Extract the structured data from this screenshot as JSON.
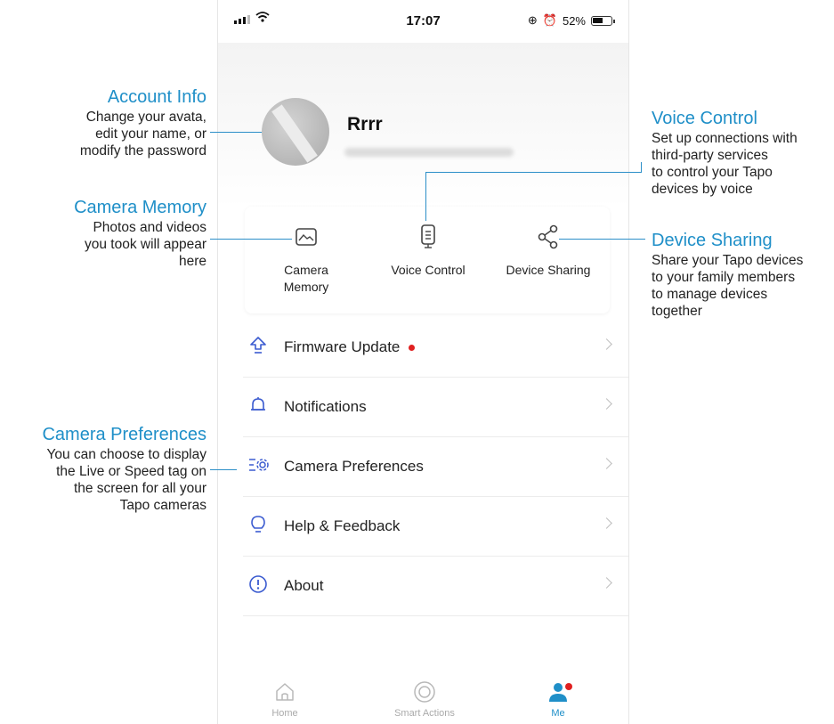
{
  "status_bar": {
    "time": "17:07",
    "battery": "52%"
  },
  "profile": {
    "username": "Rrrr"
  },
  "features": [
    {
      "label": "Camera\nMemory",
      "icon": "picture-icon"
    },
    {
      "label": "Voice Control",
      "icon": "speaker-icon"
    },
    {
      "label": "Device Sharing",
      "icon": "share-icon"
    }
  ],
  "menu": [
    {
      "label": "Firmware Update",
      "icon": "upload-icon",
      "has_dot": true
    },
    {
      "label": "Notifications",
      "icon": "bell-icon"
    },
    {
      "label": "Camera Preferences",
      "icon": "camera-settings-icon"
    },
    {
      "label": "Help & Feedback",
      "icon": "lightbulb-icon"
    },
    {
      "label": "About",
      "icon": "info-icon"
    }
  ],
  "tabbar": [
    {
      "label": "Home",
      "icon": "home-icon"
    },
    {
      "label": "Smart Actions",
      "icon": "smart-actions-icon"
    },
    {
      "label": "Me",
      "icon": "user-icon",
      "active": true
    }
  ],
  "annotations": {
    "account_info": {
      "title": "Account Info",
      "desc": "Change your avata,\nedit your name, or\nmodify the password"
    },
    "camera_memory": {
      "title": "Camera Memory",
      "desc": "Photos and videos\nyou took will appear\nhere"
    },
    "camera_preferences": {
      "title": "Camera Preferences",
      "desc": "You can choose to display\nthe Live or Speed tag on\nthe screen for all your\nTapo cameras"
    },
    "voice_control": {
      "title": "Voice Control",
      "desc": "Set up connections with\nthird-party services\nto control your Tapo\ndevices by voice"
    },
    "device_sharing": {
      "title": "Device Sharing",
      "desc": "Share your Tapo devices\nto your family members\nto manage devices\ntogether"
    }
  },
  "colors": {
    "accent": "#1f8fc8",
    "dot": "#e02020"
  }
}
